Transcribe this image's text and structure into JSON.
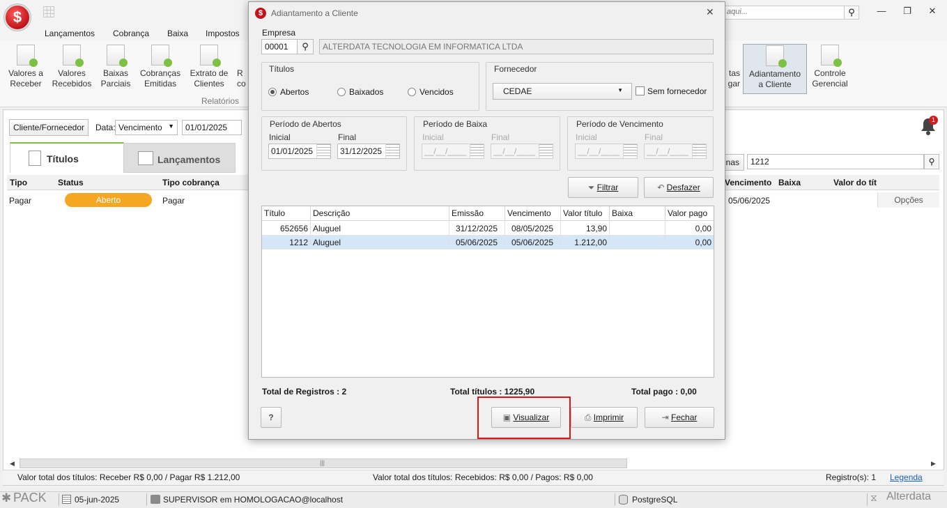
{
  "app": {
    "search_placeholder": "aqui...",
    "menu": [
      "Lançamentos",
      "Cobrança",
      "Baixa",
      "Impostos"
    ],
    "ribbon_left": [
      {
        "label1": "Valores a",
        "label2": "Receber"
      },
      {
        "label1": "Valores",
        "label2": "Recebidos"
      },
      {
        "label1": "Baixas",
        "label2": "Parciais"
      },
      {
        "label1": "Cobranças",
        "label2": "Emitidas"
      },
      {
        "label1": "Extrato de",
        "label2": "Clientes"
      },
      {
        "label1": "R",
        "label2": "co"
      }
    ],
    "ribbon_group": "Relatórios",
    "ribbon_right": [
      {
        "label1": "tas",
        "label2": "gar"
      },
      {
        "label1": "Adiantamento",
        "label2": "a Cliente"
      },
      {
        "label1": "Controle",
        "label2": "Gerencial"
      }
    ]
  },
  "main": {
    "client_btn": "Cliente/Fornecedor",
    "data_label": "Data:",
    "data_type": "Vencimento",
    "date_from": "01/01/2025",
    "tabs": [
      "Títulos",
      "Lançamentos"
    ],
    "notif_count": "1",
    "right_btn_partial": "nas",
    "search_value": "1212",
    "left_headers": [
      "Tipo",
      "Status",
      "Tipo cobrança"
    ],
    "right_headers": [
      "Vencimento",
      "Baixa",
      "Valor do tít"
    ],
    "row": {
      "tipo": "Pagar",
      "status": "Aberto",
      "tipo_cobranca": "Pagar",
      "vencimento": "05/06/2025",
      "opcoes": "Opções"
    },
    "footer_left": "Valor total dos títulos: Receber R$ 0,00 / Pagar R$ 1.212,00",
    "footer_mid": "Valor total dos títulos: Recebidos: R$ 0,00 / Pagos: R$ 0,00",
    "footer_registros": "Registro(s): 1",
    "footer_legenda": "Legenda"
  },
  "statusbar": {
    "brand": "PACK",
    "date": "05-jun-2025",
    "user": "SUPERVISOR em HOMOLOGACAO@localhost",
    "db": "PostgreSQL",
    "vendor": "Alterdata"
  },
  "dialog": {
    "title": "Adiantamento a Cliente",
    "empresa_label": "Empresa",
    "empresa_code": "00001",
    "empresa_name": "ALTERDATA TECNOLOGIA EM INFORMATICA LTDA",
    "titulos_label": "Títulos",
    "radios": [
      "Abertos",
      "Baixados",
      "Vencidos"
    ],
    "fornecedor_label": "Fornecedor",
    "fornecedor_value": "CEDAE",
    "sem_fornecedor": "Sem fornecedor",
    "periodo_abertos": "Período de Abertos",
    "periodo_baixa": "Período de Baixa",
    "periodo_vencimento": "Período de Vencimento",
    "inicial": "Inicial",
    "final": "Final",
    "abertos_inicial": "01/01/2025",
    "abertos_final": "31/12/2025",
    "empty_date": "__/__/____",
    "filtrar": "Filtrar",
    "desfazer": "Desfazer",
    "columns": [
      "Título",
      "Descrição",
      "Emissão",
      "Vencimento",
      "Valor título",
      "Baixa",
      "Valor pago"
    ],
    "rows": [
      [
        "652656",
        "Aluguel",
        "31/12/2025",
        "08/05/2025",
        "13,90",
        "",
        "0,00"
      ],
      [
        "1212",
        "Aluguel",
        "05/06/2025",
        "05/06/2025",
        "1.212,00",
        "",
        "0,00"
      ]
    ],
    "total_registros": "Total de Registros : 2",
    "total_titulos": "Total títulos : 1225,90",
    "total_pago": "Total pago : 0,00",
    "help": "?",
    "visualizar": "Visualizar",
    "imprimir": "Imprimir",
    "fechar": "Fechar"
  }
}
